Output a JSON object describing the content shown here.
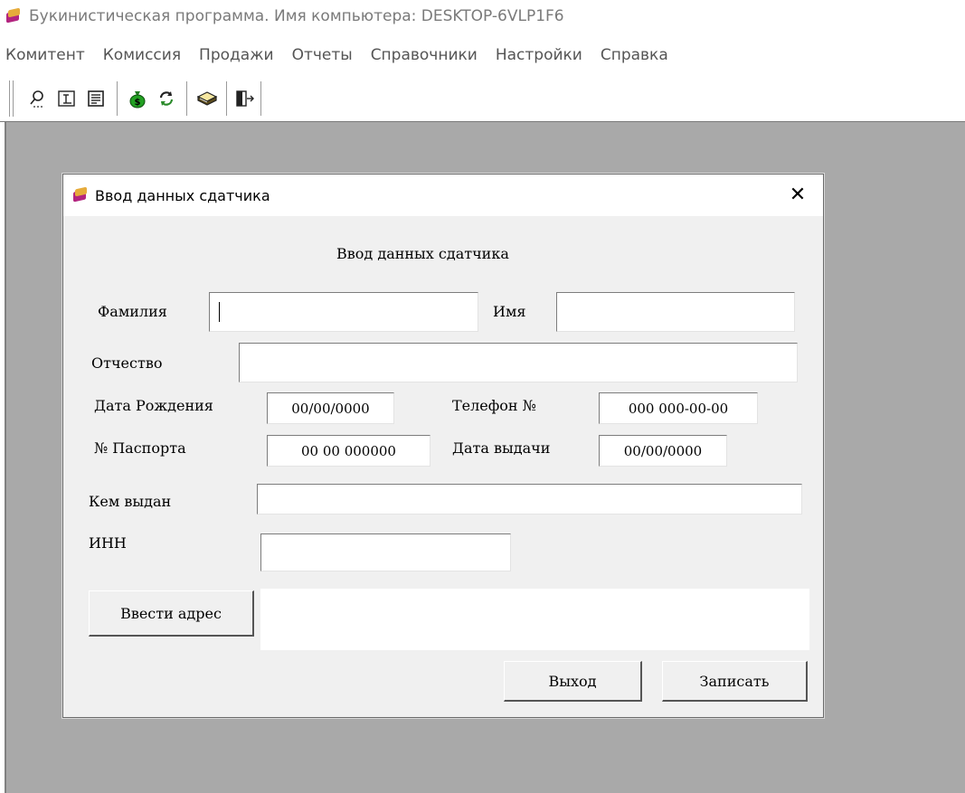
{
  "window": {
    "title": "Букинистическая программа. Имя компьютера: DESKTOP-6VLP1F6"
  },
  "menu": [
    {
      "label": "Комитент"
    },
    {
      "label": "Комиссия"
    },
    {
      "label": "Продажи"
    },
    {
      "label": "Отчеты"
    },
    {
      "label": "Справочники"
    },
    {
      "label": "Настройки"
    },
    {
      "label": "Справка"
    }
  ],
  "toolbar": {
    "icons": [
      "search-icon",
      "text-cursor-icon",
      "document-icon",
      "money-bag-icon",
      "refresh-icon",
      "book-icon",
      "exit-door-icon"
    ]
  },
  "dialog": {
    "title": "Ввод данных сдатчика",
    "heading": "Ввод данных сдатчика",
    "close_glyph": "✕",
    "fields": {
      "surname": {
        "label": "Фамилия",
        "value": ""
      },
      "name": {
        "label": "Имя",
        "value": ""
      },
      "patronymic": {
        "label": "Отчество",
        "value": ""
      },
      "birth_date": {
        "label": "Дата Рождения",
        "value": "00/00/0000"
      },
      "phone": {
        "label": "Телефон №",
        "value": "000 000-00-00"
      },
      "passport": {
        "label": "№ Паспорта",
        "value": "00 00 000000"
      },
      "issue_date": {
        "label": "Дата выдачи",
        "value": "00/00/0000"
      },
      "issued_by": {
        "label": "Кем выдан",
        "value": ""
      },
      "inn": {
        "label": "ИНН",
        "value": ""
      },
      "address": {
        "value": ""
      }
    },
    "buttons": {
      "enter_address": "Ввести адрес",
      "exit": "Выход",
      "save": "Записать"
    }
  }
}
